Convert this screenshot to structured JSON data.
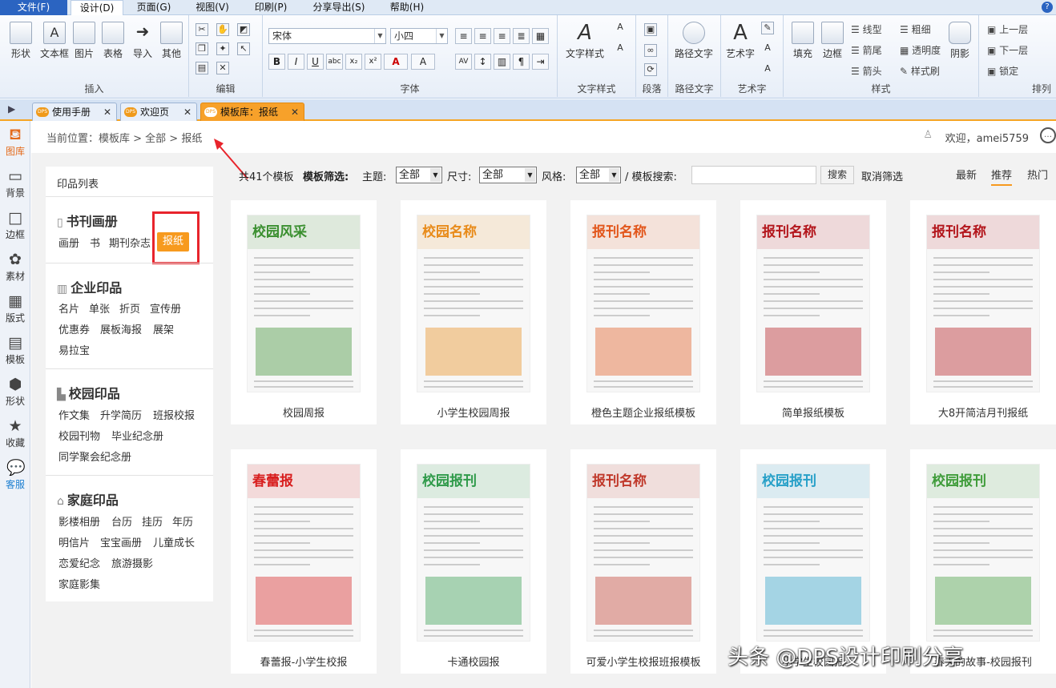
{
  "menu": [
    "文件(F)",
    "设计(D)",
    "页面(G)",
    "视图(V)",
    "印刷(P)",
    "分享导出(S)",
    "帮助(H)"
  ],
  "ribbon": {
    "insert": {
      "label": "插入",
      "buttons": [
        "形状",
        "文本框",
        "图片",
        "表格",
        "导入",
        "其他"
      ]
    },
    "edit": {
      "label": "编辑"
    },
    "font": {
      "label": "字体",
      "font_name": "宋体",
      "font_size": "小四"
    },
    "text_style": {
      "label": "文字样式",
      "button": "文字样式"
    },
    "paragraph": {
      "label": "段落"
    },
    "path_text": {
      "label": "路径文字",
      "button": "路径文字"
    },
    "art_text": {
      "label": "艺术字",
      "button": "艺术字"
    },
    "style": {
      "label": "样式",
      "fill": "填充",
      "border": "边框",
      "line_type": "线型",
      "arrow_head": "箭尾",
      "arrow_tail": "箭头",
      "thickness": "粗细",
      "transparency": "透明度",
      "format_brush": "样式刷",
      "shadow": "阴影"
    },
    "arrange": {
      "label": "排列",
      "up": "上一层",
      "down": "下一层",
      "lock": "锁定"
    }
  },
  "doc_tabs": [
    "使用手册",
    "欢迎页",
    "模板库：报纸"
  ],
  "dps_badge": "DPS",
  "leftbar": [
    "图库",
    "背景",
    "边框",
    "素材",
    "版式",
    "模板",
    "形状",
    "收藏",
    "客服"
  ],
  "breadcrumb": "当前位置：模板库 > 全部 > 报纸",
  "welcome": "欢迎，amei5759",
  "catalog": {
    "title": "印品列表",
    "sections": [
      {
        "name": "书刊画册",
        "items": [
          "画册",
          "书",
          "期刊杂志",
          "报纸"
        ]
      },
      {
        "name": "企业印品",
        "items": [
          "名片",
          "单张",
          "折页",
          "宣传册",
          "优惠券",
          "展板海报",
          "展架",
          "易拉宝"
        ]
      },
      {
        "name": "校园印品",
        "items": [
          "作文集",
          "升学简历",
          "班报校报",
          "校园刊物",
          "毕业纪念册",
          "同学聚会纪念册"
        ]
      },
      {
        "name": "家庭印品",
        "items": [
          "影楼相册",
          "台历",
          "挂历",
          "年历",
          "明信片",
          "宝宝画册",
          "儿童成长",
          "恋爱纪念",
          "旅游摄影",
          "家庭影集"
        ]
      }
    ]
  },
  "filter": {
    "count": "共41个模板",
    "filter_label": "模板筛选:",
    "theme_label": "主题:",
    "theme_value": "全部",
    "size_label": "尺寸:",
    "size_value": "全部",
    "style_label": "风格:",
    "style_value": "全部",
    "search_label": "/ 模板搜索:",
    "search_button": "搜索",
    "clear": "取消筛选",
    "sort": [
      "最新",
      "推荐",
      "热门"
    ]
  },
  "templates": [
    {
      "caption": "校园周报",
      "title": "校园风采",
      "color": "#3a8f2f"
    },
    {
      "caption": "小学生校园周报",
      "title": "校园名称",
      "color": "#e88b1a"
    },
    {
      "caption": "橙色主题企业报纸模板",
      "title": "报刊名称",
      "color": "#e2571c"
    },
    {
      "caption": "简单报纸模板",
      "title": "报刊名称",
      "color": "#b3161c"
    },
    {
      "caption": "大8开简洁月刊报纸",
      "title": "报刊名称",
      "color": "#b3161c"
    },
    {
      "caption": "春蕾报-小学生校报",
      "title": "春蕾报",
      "color": "#d81e1e"
    },
    {
      "caption": "卡通校园报",
      "title": "校园报刊",
      "color": "#2f9a4a"
    },
    {
      "caption": "可爱小学生校报班报模板",
      "title": "报刊名称",
      "color": "#c0392b"
    },
    {
      "caption": "小学生校园报",
      "title": "校园报刊",
      "color": "#27a0c8"
    },
    {
      "caption": "春天的故事-校园报刊",
      "title": "校园报刊",
      "color": "#3f9c3a"
    }
  ],
  "watermark": "头条 @DPS设计印刷分享"
}
